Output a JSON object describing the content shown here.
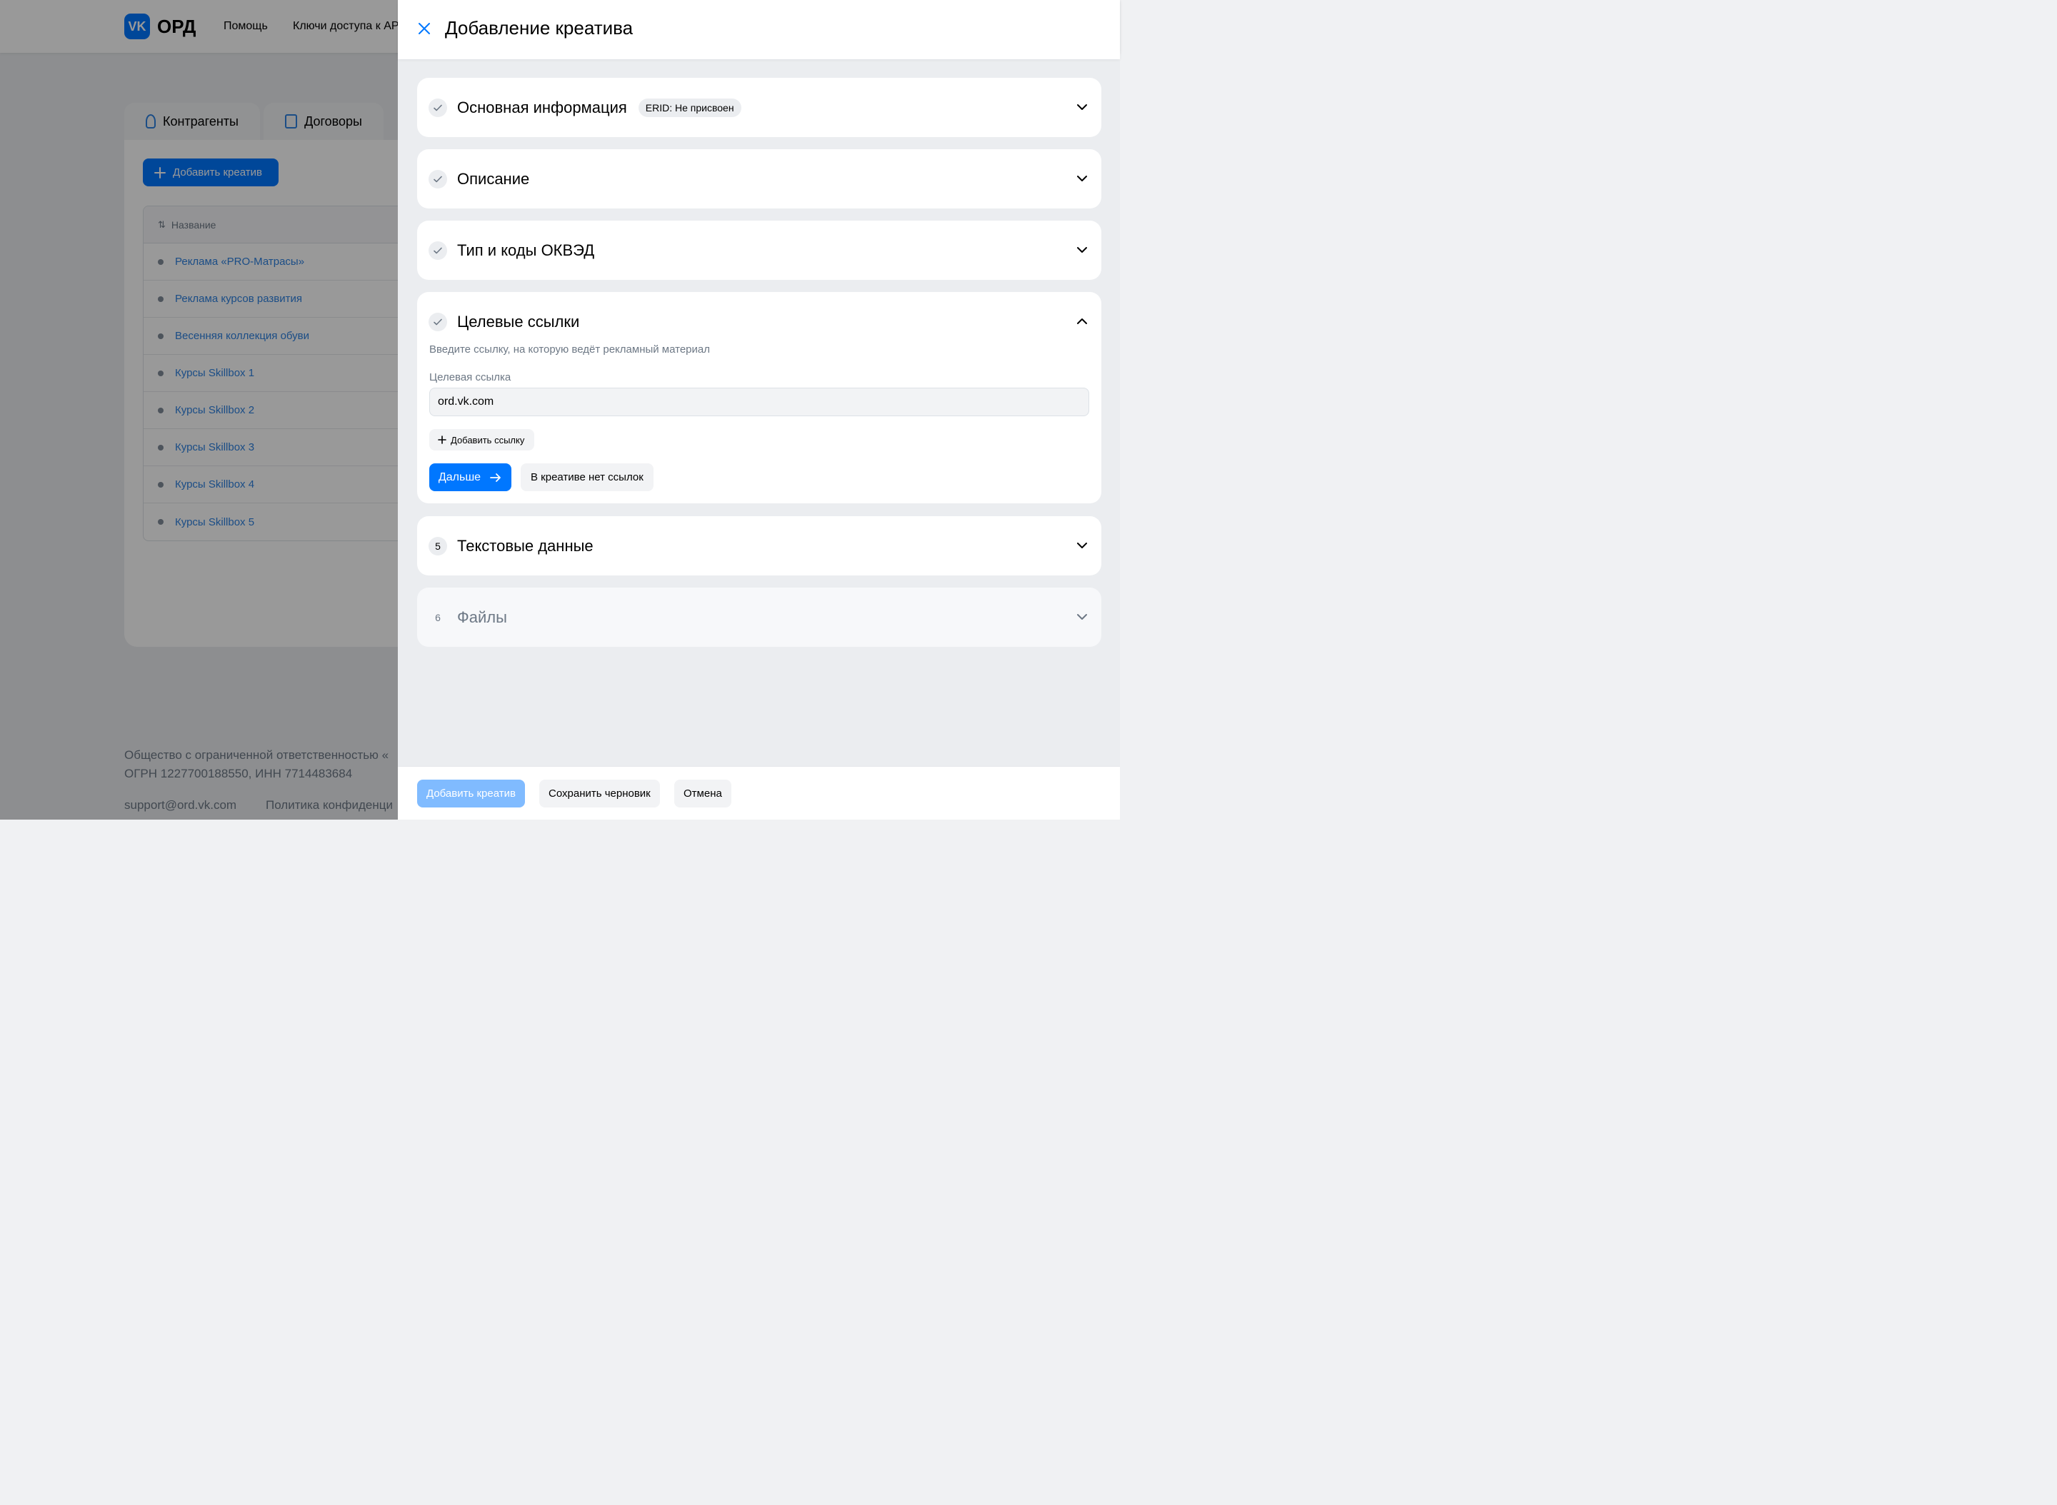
{
  "app": {
    "logo_letters": "VK",
    "logo_text": "ОРД",
    "nav": [
      "Помощь",
      "Ключи доступа к API"
    ]
  },
  "tabs": [
    "Контрагенты",
    "Договоры"
  ],
  "list": {
    "add_button": "Добавить креатив",
    "column_header": "Название",
    "rows": [
      "Реклама «PRO-Матрасы»",
      "Реклама курсов развития",
      "Весенняя коллекция обуви",
      "Курсы Skillbox 1",
      "Курсы Skillbox 2",
      "Курсы Skillbox 3",
      "Курсы Skillbox 4",
      "Курсы Skillbox 5"
    ]
  },
  "footer": {
    "company": "Общество с ограниченной ответственностью «",
    "requisites": "ОГРН 1227700188550, ИНН 7714483684",
    "support": "support@ord.vk.com",
    "privacy": "Политика конфиденци"
  },
  "drawer": {
    "title": "Добавление креатива",
    "sections": [
      {
        "title": "Основная информация",
        "status": "done",
        "badge": "ERID: Не присвоен"
      },
      {
        "title": "Описание",
        "status": "done"
      },
      {
        "title": "Тип и коды ОКВЭД",
        "status": "done"
      },
      {
        "title": "Целевые ссылки",
        "status": "done",
        "expanded": true
      },
      {
        "title": "Текстовые данные",
        "status": "number",
        "number": "5"
      },
      {
        "title": "Файлы",
        "status": "number",
        "number": "6",
        "disabled": true
      }
    ],
    "links": {
      "hint": "Введите ссылку, на которую ведёт рекламный материал",
      "field_label": "Целевая ссылка",
      "field_value": "ord.vk.com",
      "add_link": "Добавить ссылку",
      "next": "Дальше",
      "no_links": "В креативе нет ссылок"
    },
    "footer": {
      "submit": "Добавить креатив",
      "save_draft": "Сохранить черновик",
      "cancel": "Отмена"
    }
  },
  "colors": {
    "accent": "#0077ff",
    "accent_disabled": "#80bbff",
    "muted_text": "#6d7885",
    "overlay": "rgba(0,0,0,0.4)"
  }
}
